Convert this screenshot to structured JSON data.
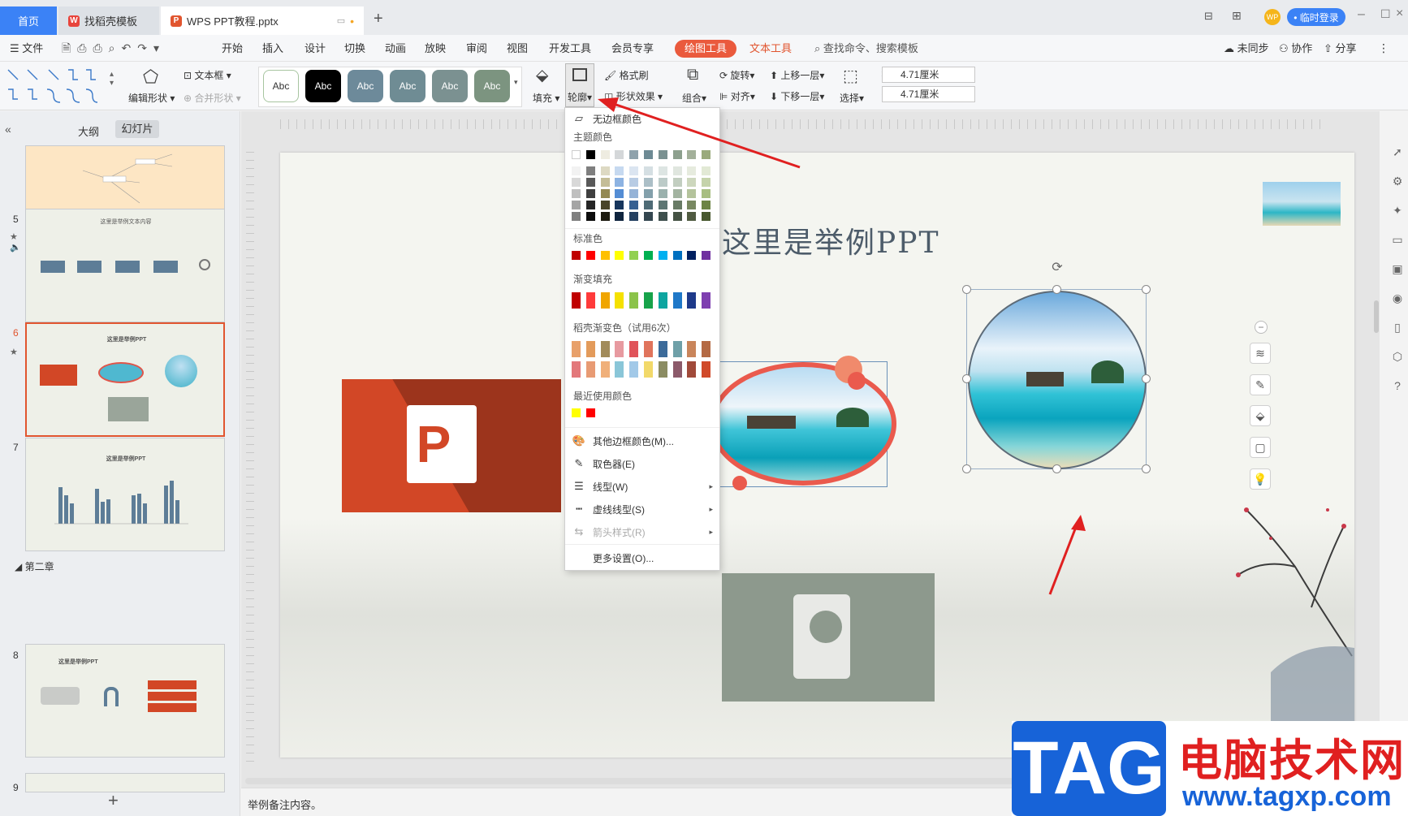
{
  "titlebar": {
    "tabs": [
      {
        "label": "首页"
      },
      {
        "label": "找稻壳模板"
      },
      {
        "label": "WPS PPT教程.pptx"
      }
    ],
    "login_label": "• 临时登录"
  },
  "menubar": {
    "file": "文件",
    "items": [
      "开始",
      "插入",
      "设计",
      "切换",
      "动画",
      "放映",
      "审阅",
      "视图",
      "开发工具",
      "会员专享"
    ],
    "drawing_tools": "绘图工具",
    "text_tools": "文本工具",
    "search_placeholder": "查找命令、搜索模板",
    "sync": "未同步",
    "collab": "协作",
    "share": "分享"
  },
  "ribbon": {
    "edit_shape": "编辑形状",
    "text_box": "文本框",
    "merge_shape": "合并形状",
    "style_abc": "Abc",
    "fill": "填充",
    "outline": "轮廓",
    "format_painter": "格式刷",
    "shape_effect": "形状效果",
    "rotate": "旋转",
    "bring_forward": "上移一层",
    "combine": "组合",
    "align": "对齐",
    "send_backward": "下移一层",
    "select": "选择",
    "height": "4.71厘米",
    "width": "4.71厘米",
    "style_colors": [
      "#ffffff",
      "#000000",
      "#6d8a9a",
      "#6f8c94",
      "#7b9191",
      "#7c9480"
    ]
  },
  "leftpanel": {
    "tab_outline": "大纲",
    "tab_slides": "幻灯片",
    "section": "第二章",
    "slides": [
      {
        "num": "5",
        "title": "这里是举例文本内容"
      },
      {
        "num": "6",
        "title": "这里是举例PPT"
      },
      {
        "num": "7",
        "title": "这里是举例PPT"
      },
      {
        "num": "8",
        "title": "这里是举例PPT"
      },
      {
        "num": "9",
        "title": ""
      }
    ]
  },
  "slide": {
    "title": "这里是举例PPT"
  },
  "dropdown": {
    "no_border": "无边框颜色",
    "theme_colors": "主题颜色",
    "standard_colors": "标准色",
    "gradient_fill": "渐变填充",
    "daoke_gradient": "稻壳渐变色（试用6次）",
    "recent_colors": "最近使用颜色",
    "more_colors": "其他边框颜色(M)...",
    "eyedropper": "取色器(E)",
    "line_type": "线型(W)",
    "dash_type": "虚线线型(S)",
    "arrow_style": "箭头样式(R)",
    "more_settings": "更多设置(O)...",
    "theme_top_row": [
      "#ffffff",
      "#000000",
      "#eeece1",
      "#d4d7d9",
      "#8fa2ac",
      "#6d8a94",
      "#7a9191",
      "#8da08e",
      "#a3b09a",
      "#9aaa7c"
    ],
    "standard_row": [
      "#c00000",
      "#ff0000",
      "#ffc000",
      "#ffff00",
      "#92d050",
      "#00b050",
      "#00b0f0",
      "#0070c0",
      "#002060",
      "#7030a0"
    ],
    "gradient_row": [
      "#c00000",
      "#ff3b3b",
      "#f0a500",
      "#f5e100",
      "#8bc34a",
      "#17a34a",
      "#0ea5a0",
      "#1f78c8",
      "#1e3a8a",
      "#7e3fb0"
    ],
    "daoke_row1": [
      "#e8a06a",
      "#e39b5b",
      "#a18b5a",
      "#e79aa0",
      "#e0545a",
      "#e0745c",
      "#3c6b9a",
      "#6fa0a8",
      "#c9855b",
      "#b46a44"
    ],
    "daoke_row2": [
      "#e3787b",
      "#e89b74",
      "#f0b07a",
      "#8ac6d8",
      "#a2c9e8",
      "#f2d96a",
      "#8b8c62",
      "#8c5a6a",
      "#a04a3a",
      "#d04a2a"
    ],
    "recent": [
      "#ffff00",
      "#ff0000"
    ]
  },
  "statusbar": {
    "notes": "举例备注内容。"
  },
  "watermark": {
    "tag": "TAG",
    "site_name": "电脑技术网",
    "url": "www.tagxp.com"
  }
}
